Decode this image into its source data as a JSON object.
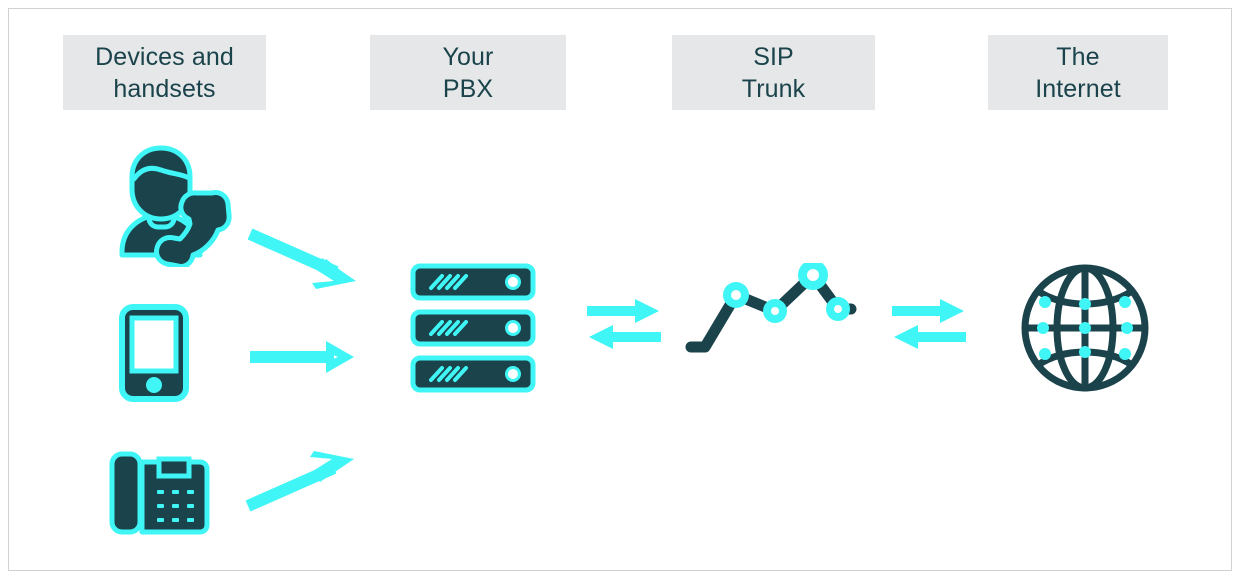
{
  "diagram": {
    "title_alt": "SIP trunking connectivity diagram",
    "background_color": "#ffffff",
    "border_color": "#cfd2d4",
    "palette": {
      "dark_teal": "#1b434b",
      "cyan": "#3ff5f5",
      "header_chip_bg": "#e5e7e8",
      "header_text": "#1b434b",
      "white": "#ffffff"
    },
    "columns": [
      {
        "id": "devices",
        "label": "Devices and\nhandsets"
      },
      {
        "id": "pbx",
        "label": "Your\nPBX"
      },
      {
        "id": "sip",
        "label": "SIP\nTrunk"
      },
      {
        "id": "internet",
        "label": "The\nInternet"
      }
    ],
    "nodes": [
      {
        "id": "person",
        "icon": "person-with-phone-handset-icon",
        "column": "devices"
      },
      {
        "id": "mobile",
        "icon": "mobile-phone-icon",
        "column": "devices"
      },
      {
        "id": "deskphone",
        "icon": "desk-phone-icon",
        "column": "devices"
      },
      {
        "id": "servers",
        "icon": "server-stack-icon",
        "column": "pbx",
        "units": 3
      },
      {
        "id": "sipchart",
        "icon": "network-line-chart-icon",
        "column": "sip",
        "points": 4
      },
      {
        "id": "globe",
        "icon": "globe-network-icon",
        "column": "internet",
        "dots": 9
      }
    ],
    "connectors": [
      {
        "id": "person-to-pbx",
        "style": "single-arrow",
        "direction": "down-right"
      },
      {
        "id": "mobile-to-pbx",
        "style": "single-arrow",
        "direction": "right"
      },
      {
        "id": "deskphone-to-pbx",
        "style": "single-arrow",
        "direction": "up-right"
      },
      {
        "id": "pbx-to-sip",
        "style": "bidirectional",
        "direction": "right-and-left"
      },
      {
        "id": "sip-to-internet",
        "style": "bidirectional",
        "direction": "right-and-left"
      }
    ]
  }
}
